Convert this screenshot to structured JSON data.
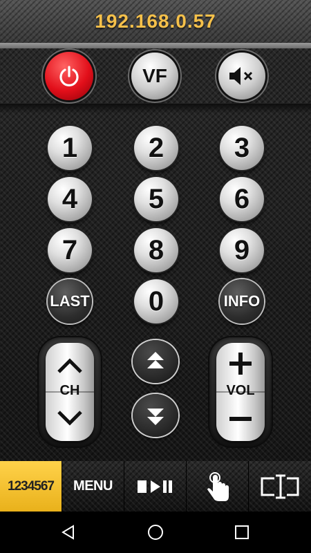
{
  "header": {
    "ip_address": "192.168.0.57"
  },
  "top_controls": {
    "power_label": "power",
    "vf_label": "VF",
    "mute_label": "mute"
  },
  "keypad": {
    "digits": [
      "1",
      "2",
      "3",
      "4",
      "5",
      "6",
      "7",
      "8",
      "9",
      "0"
    ],
    "last_label": "LAST",
    "info_label": "INFO"
  },
  "rockers": {
    "channel_label": "CH",
    "volume_label": "VOL"
  },
  "toolbar": {
    "items": [
      {
        "label": "1234567",
        "active": true
      },
      {
        "label": "MENU",
        "active": false
      },
      {
        "label": "playback-controls",
        "active": false
      },
      {
        "label": "touch-pointer",
        "active": false
      },
      {
        "label": "cast-screen",
        "active": false
      }
    ]
  },
  "colors": {
    "accent": "#f5c04a",
    "power_red": "#e20f1a",
    "active_tab": "#f2c33a"
  },
  "icons": [
    "power-icon",
    "mute-icon",
    "page-up-icon",
    "page-down-icon",
    "play-pause-icon",
    "touch-icon",
    "screen-icon",
    "back-icon",
    "home-icon",
    "recents-icon"
  ]
}
